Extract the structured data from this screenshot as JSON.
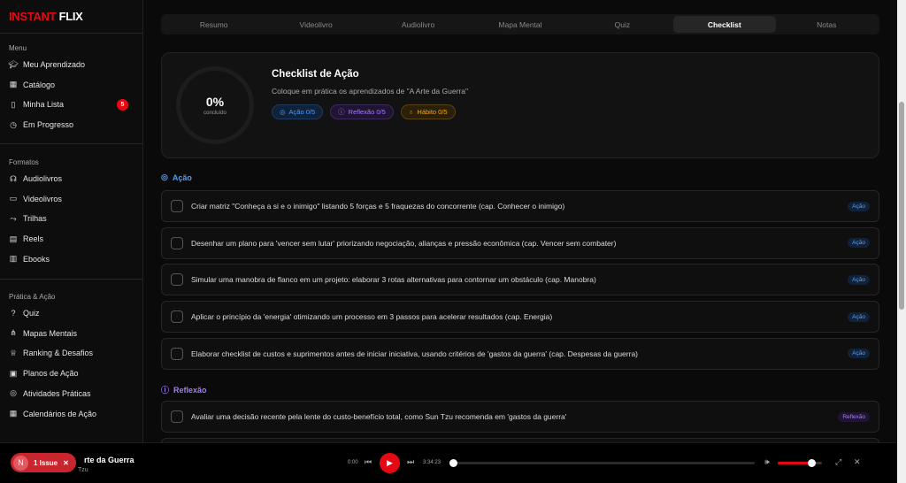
{
  "brand": {
    "part1": "INSTANT",
    "part2": "FLIX"
  },
  "sidebar": {
    "sections": [
      {
        "title": "Menu",
        "items": [
          {
            "label": "Meu Aprendizado",
            "icon": "graduation-cap-icon"
          },
          {
            "label": "Catálogo",
            "icon": "grid-icon"
          },
          {
            "label": "Minha Lista",
            "icon": "bookmark-icon",
            "badge": "5"
          },
          {
            "label": "Em Progresso",
            "icon": "clock-icon"
          }
        ]
      },
      {
        "title": "Formatos",
        "items": [
          {
            "label": "Audiolivros",
            "icon": "headphones-icon"
          },
          {
            "label": "Videolivros",
            "icon": "video-icon"
          },
          {
            "label": "Trilhas",
            "icon": "route-icon"
          },
          {
            "label": "Reels",
            "icon": "film-icon"
          },
          {
            "label": "Ebooks",
            "icon": "book-icon"
          }
        ]
      },
      {
        "title": "Prática & Ação",
        "items": [
          {
            "label": "Quiz",
            "icon": "help-circle-icon"
          },
          {
            "label": "Mapas Mentais",
            "icon": "network-icon"
          },
          {
            "label": "Ranking & Desafios",
            "icon": "trophy-icon"
          },
          {
            "label": "Planos de Ação",
            "icon": "clipboard-icon"
          },
          {
            "label": "Atividades Práticas",
            "icon": "target-icon"
          },
          {
            "label": "Calendários de Ação",
            "icon": "calendar-icon"
          }
        ]
      }
    ]
  },
  "tabs": [
    "Resumo",
    "Videolivro",
    "Audiolivro",
    "Mapa Mental",
    "Quiz",
    "Checklist",
    "Notas"
  ],
  "active_tab": "Checklist",
  "header": {
    "percent": "0%",
    "percent_label": "concluído",
    "progress": 0,
    "title": "Checklist de Ação",
    "subtitle": "Coloque em prática os aprendizados de \"A Arte da Guerra\"",
    "chips": {
      "acao": "Ação 0/5",
      "reflexao": "Reflexão 0/5",
      "habito": "Hábito 0/5"
    }
  },
  "sections": {
    "acao": {
      "title": "Ação",
      "color": "#4f9cf5",
      "items": [
        {
          "text": "Criar matriz \"Conheça a si e o inimigo\" listando 5 forças e 5 fraquezas do concorrente (cap. Conhecer o inimigo)",
          "tag": "Ação"
        },
        {
          "text": "Desenhar um plano para 'vencer sem lutar' priorizando negociação, alianças e pressão econômica (cap. Vencer sem combater)",
          "tag": "Ação"
        },
        {
          "text": "Simular uma manobra de flanco em um projeto: elaborar 3 rotas alternativas para contornar um obstáculo (cap. Manobra)",
          "tag": "Ação"
        },
        {
          "text": "Aplicar o princípio da 'energia' otimizando um processo em 3 passos para acelerar resultados (cap. Energia)",
          "tag": "Ação"
        },
        {
          "text": "Elaborar checklist de custos e suprimentos antes de iniciar iniciativa, usando critérios de 'gastos da guerra' (cap. Despesas da guerra)",
          "tag": "Ação"
        }
      ]
    },
    "reflexao": {
      "title": "Reflexão",
      "color": "#a67cf4",
      "items": [
        {
          "text": "Avaliar uma decisão recente pela lente do custo-benefício total, como Sun Tzu recomenda em 'gastos da guerra'",
          "tag": "Reflexão"
        }
      ]
    }
  },
  "player": {
    "title": "A Arte da Guerra",
    "title_visible": "rte da Guerra",
    "author_visible": "Tzu",
    "current": "0:00",
    "duration": "3:34:23",
    "progress": 0,
    "volume": 0.75
  },
  "issue": {
    "avatar": "N",
    "label": "1 Issue"
  }
}
